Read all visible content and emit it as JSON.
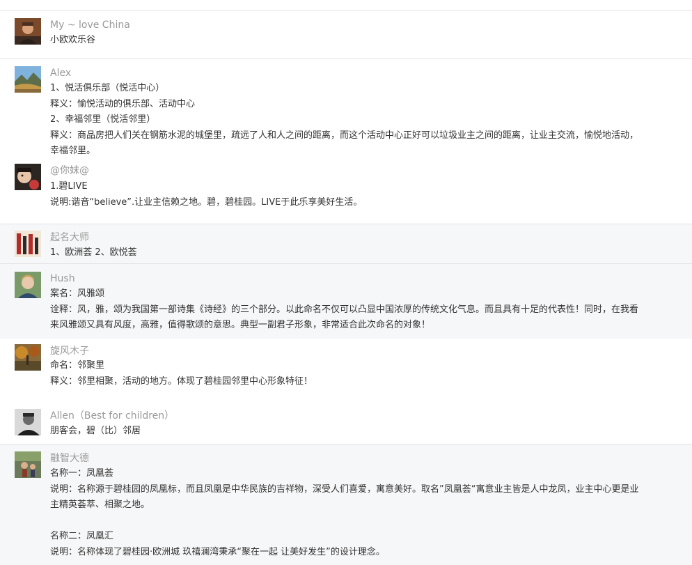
{
  "comments": [
    {
      "name": "My ~ love China",
      "lines": [
        "小欧欢乐谷"
      ]
    },
    {
      "name": "Alex",
      "lines": [
        "1、悦活俱乐部（悦活中心）",
        "释义：愉悦活动的俱乐部、活动中心",
        "2、幸福邻里（悦活邻里）",
        "释义：商品房把人们关在钢筋水泥的城堡里，疏远了人和人之间的距离，而这个活动中心正好可以垃圾业主之间的距离，让业主交流，愉悦地活动，",
        "幸福邻里。"
      ]
    },
    {
      "name": "@你妹@",
      "lines": [
        "1.碧LIVE",
        "说明:谐音“believe”.让业主信赖之地。碧，碧桂园。LIVE于此乐享美好生活。"
      ]
    },
    {
      "name": "起名大师",
      "lines": [
        "1、欧洲荟 2、欧悦荟"
      ]
    },
    {
      "name": "Hush",
      "lines": [
        "案名：风雅颂",
        "诠释：风，雅，颂为我国第一部诗集《诗经》的三个部分。以此命名不仅可以凸显中国浓厚的传统文化气息。而且具有十足的代表性！同时，在我看",
        "来风雅颂又具有风度，高雅，值得歌颂的意思。典型一副君子形象，非常适合此次命名的对象！"
      ]
    },
    {
      "name": "旋风木子",
      "lines": [
        "命名：邻聚里",
        "释义：邻里相聚，活动的地方。体现了碧桂园邻里中心形象特征！"
      ]
    },
    {
      "name": "Allen（Best for children）",
      "lines": [
        "朋客会，碧（比）邻居"
      ]
    },
    {
      "name": "融智大德",
      "lines": [
        "名称一：凤凰荟",
        "说明：名称源于碧桂园的凤凰标，而且凤凰是中华民族的吉祥物，深受人们喜爱，寓意美好。取名”凤凰荟“寓意业主皆是人中龙凤，业主中心更是业",
        "主精英荟萃、相聚之地。",
        "",
        "名称二：凤凰汇",
        "说明：名称体现了碧桂园·欧洲城 玖禧澜湾秉承“聚在一起 让美好发生”的设计理念。"
      ]
    }
  ]
}
